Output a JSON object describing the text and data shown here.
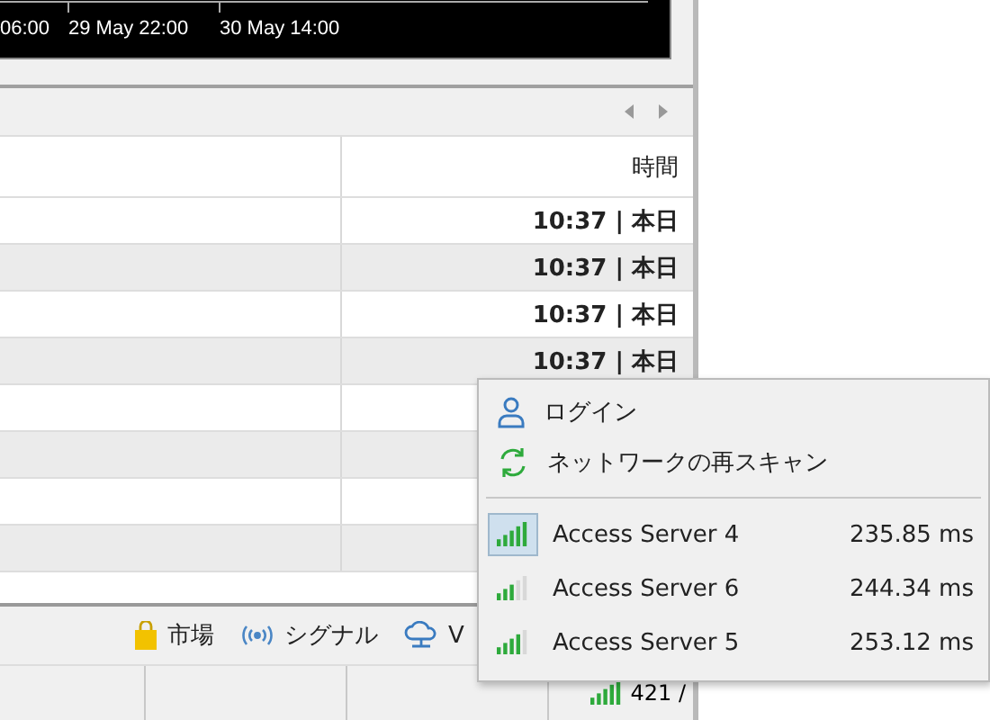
{
  "chart": {
    "axis_labels": [
      "06:00",
      "29 May 22:00",
      "30 May 14:00"
    ]
  },
  "table": {
    "columns": [
      "時間"
    ],
    "rows": [
      {
        "time": "10:37 | 本日"
      },
      {
        "time": "10:37 | 本日"
      },
      {
        "time": "10:37 | 本日"
      },
      {
        "time": "10:37 | 本日"
      }
    ]
  },
  "toolbar": [
    {
      "kind": "market",
      "label": "市場"
    },
    {
      "kind": "signals",
      "label": "シグナル"
    },
    {
      "kind": "vps",
      "label": "V"
    }
  ],
  "status_bar": {
    "connection": "421 /"
  },
  "network_menu": {
    "actions": [
      {
        "kind": "login",
        "label": "ログイン"
      },
      {
        "kind": "rescan",
        "label": "ネットワークの再スキャン"
      }
    ],
    "servers": [
      {
        "name": "Access Server 4",
        "ping": "235.85 ms",
        "kind": "full",
        "selected": true
      },
      {
        "name": "Access Server 6",
        "ping": "244.34 ms",
        "kind": "fair",
        "selected": false
      },
      {
        "name": "Access Server 5",
        "ping": "253.12 ms",
        "kind": "good",
        "selected": false
      }
    ]
  }
}
